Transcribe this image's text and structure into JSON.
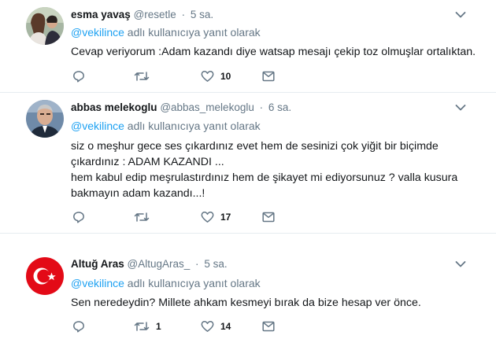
{
  "tweets": [
    {
      "name": "esma yavaş",
      "handle": "@resetle",
      "time": "5 sa.",
      "reply_mention": "@vekilince",
      "reply_suffix": " adlı kullanıcıya yanıt olarak",
      "lines": [
        "Cevap veriyorum :Adam kazandı diye watsap mesajı çekip toz olmuşlar ortalıktan."
      ],
      "retweets": "",
      "likes": "10"
    },
    {
      "name": "abbas melekoglu",
      "handle": "@abbas_melekoglu",
      "time": "6 sa.",
      "reply_mention": "@vekilince",
      "reply_suffix": " adlı kullanıcıya yanıt olarak",
      "lines": [
        "siz o meşhur gece ses çıkardınız  evet hem de sesinizi çok yiğit bir biçimde",
        "çıkardınız : ADAM KAZANDI ...",
        "hem kabul edip meşrulastırdınız hem de şikayet mi ediyorsunuz ? valla kusura",
        "bakmayın adam kazandı...!"
      ],
      "retweets": "",
      "likes": "17"
    },
    {
      "name": "Altuğ Aras",
      "handle": "@AltugAras_",
      "time": "5 sa.",
      "reply_mention": "@vekilince",
      "reply_suffix": " adlı kullanıcıya yanıt olarak",
      "lines": [
        "Sen neredeydin? Millete ahkam kesmeyi bırak da bize hesap ver önce."
      ],
      "retweets": "1",
      "likes": "14"
    }
  ],
  "colors": {
    "icon": "#657786",
    "link": "#1da1f2",
    "divider": "#e6ecf0",
    "flag_red": "#e30a17"
  },
  "icons": [
    "reply-icon",
    "retweet-icon",
    "like-icon",
    "message-icon",
    "chevron-down-icon"
  ]
}
